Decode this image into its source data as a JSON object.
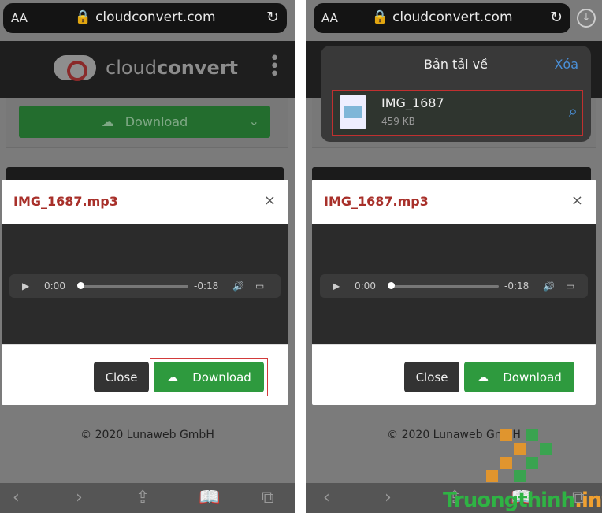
{
  "browser": {
    "text_size": "AA",
    "host": "cloudconvert.com",
    "reload_icon": "reload-icon",
    "lock_icon": "lock-icon"
  },
  "site": {
    "logo_light": "cloud",
    "logo_bold": "convert",
    "download_label": "Download",
    "footer": "© 2020 Lunaweb GmbH"
  },
  "modal": {
    "title": "IMG_1687.mp3",
    "close_x": "×",
    "player": {
      "current": "0:00",
      "remaining": "-0:18",
      "progress": 0
    },
    "close_label": "Close",
    "download_label": "Download"
  },
  "downloads_popover": {
    "title": "Bản tải về",
    "clear_label": "Xóa",
    "items": [
      {
        "name": "IMG_1687",
        "size": "459 KB"
      }
    ]
  },
  "watermark": {
    "text_green": "Truongthinh",
    "text_orange": ".info"
  },
  "colors": {
    "accent_green": "#2e9a3e",
    "title_red": "#a8302a",
    "link_blue": "#4a90d9"
  }
}
